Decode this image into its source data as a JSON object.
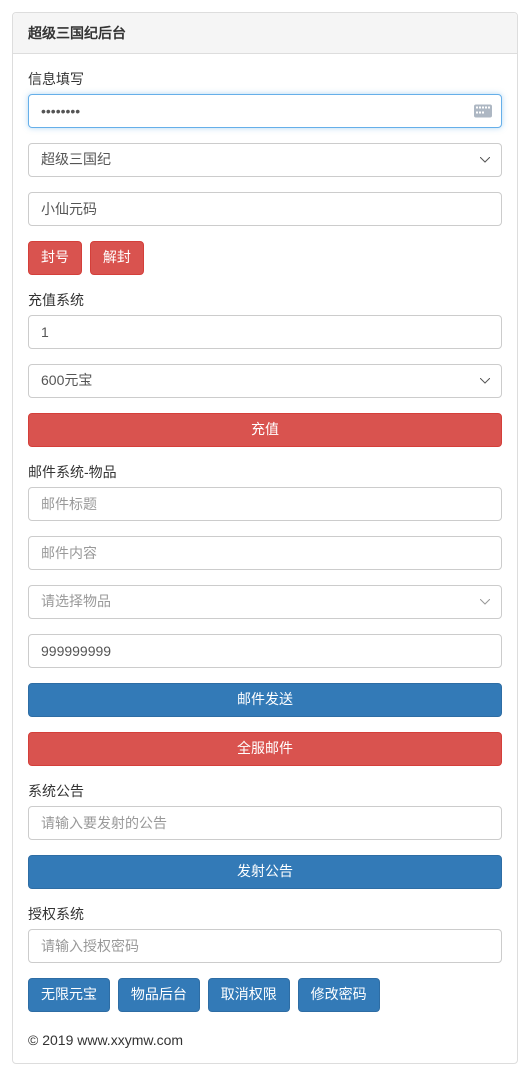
{
  "panel_title": "超级三国纪后台",
  "section_info": {
    "label": "信息填写",
    "password_value": "••••••••",
    "server_select": "超级三国纪",
    "player_value": "小仙元码",
    "btn_ban": "封号",
    "btn_unban": "解封"
  },
  "section_recharge": {
    "label": "充值系统",
    "amount_value": "1",
    "option_select": "600元宝",
    "btn_recharge": "充值"
  },
  "section_mail": {
    "label": "邮件系统-物品",
    "subject_placeholder": "邮件标题",
    "body_placeholder": "邮件内容",
    "item_select_placeholder": "请选择物品",
    "qty_value": "999999999",
    "btn_send": "邮件发送",
    "btn_global": "全服邮件"
  },
  "section_notice": {
    "label": "系统公告",
    "placeholder": "请输入要发射的公告",
    "btn_send": "发射公告"
  },
  "section_auth": {
    "label": "授权系统",
    "placeholder": "请输入授权密码",
    "btn_infinite": "无限元宝",
    "btn_items": "物品后台",
    "btn_revoke": "取消权限",
    "btn_changepw": "修改密码"
  },
  "footer_text": "© 2019 www.xxymw.com"
}
